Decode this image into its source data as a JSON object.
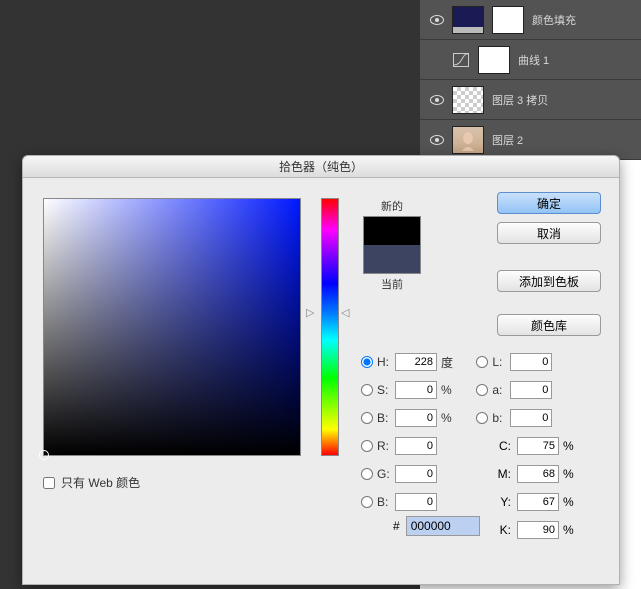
{
  "layers": {
    "fill_label": "颜色填充",
    "curves_label": "曲线 1",
    "layer3_label": "图层 3 拷贝",
    "layer2_label": "图层 2"
  },
  "dialog": {
    "title": "拾色器（纯色）",
    "new_label": "新的",
    "current_label": "当前",
    "buttons": {
      "ok": "确定",
      "cancel": "取消",
      "add_swatch": "添加到色板",
      "libraries": "颜色库"
    },
    "webonly_label": "只有 Web 颜色",
    "labels": {
      "H": "H:",
      "S": "S:",
      "B": "B:",
      "R": "R:",
      "G": "G:",
      "BB": "B:",
      "L": "L:",
      "a": "a:",
      "b": "b:",
      "C": "C:",
      "M": "M:",
      "Y": "Y:",
      "K": "K:",
      "deg": "度",
      "pct": "%",
      "hash": "#"
    },
    "values": {
      "H": "228",
      "S": "0",
      "B": "0",
      "R": "0",
      "G": "0",
      "BB": "0",
      "L": "0",
      "a": "0",
      "b": "0",
      "C": "75",
      "M": "68",
      "Y": "67",
      "K": "90",
      "hex": "000000"
    }
  }
}
